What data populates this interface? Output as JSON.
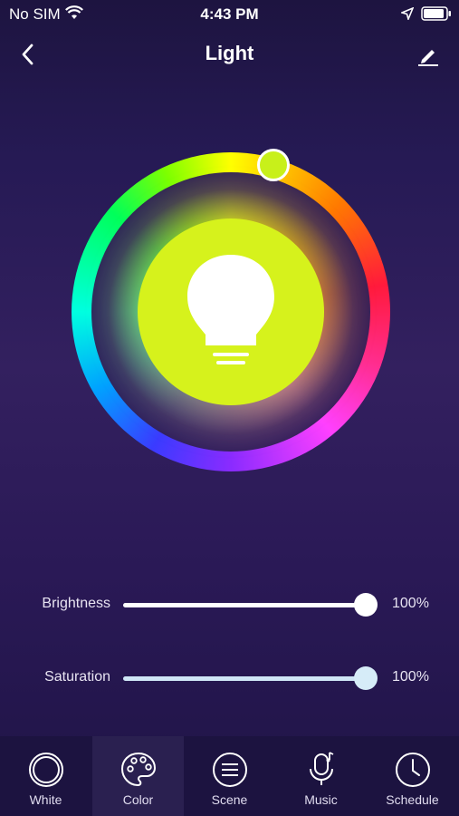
{
  "status_bar": {
    "carrier": "No SIM",
    "time": "4:43 PM"
  },
  "nav": {
    "title": "Light"
  },
  "color_wheel": {
    "selected_color": "#c8f01a",
    "bulb_color": "#d6f21c"
  },
  "sliders": [
    {
      "label": "Brightness",
      "value_text": "100%",
      "level_percent": 100
    },
    {
      "label": "Saturation",
      "value_text": "100%",
      "level_percent": 100
    }
  ],
  "tabs": [
    {
      "label": "White",
      "icon": "white-icon"
    },
    {
      "label": "Color",
      "icon": "palette-icon",
      "active": true
    },
    {
      "label": "Scene",
      "icon": "scene-icon"
    },
    {
      "label": "Music",
      "icon": "music-icon"
    },
    {
      "label": "Schedule",
      "icon": "clock-icon"
    }
  ],
  "colors": {
    "background": "#2a1956",
    "tabbar": "#1c1340"
  }
}
